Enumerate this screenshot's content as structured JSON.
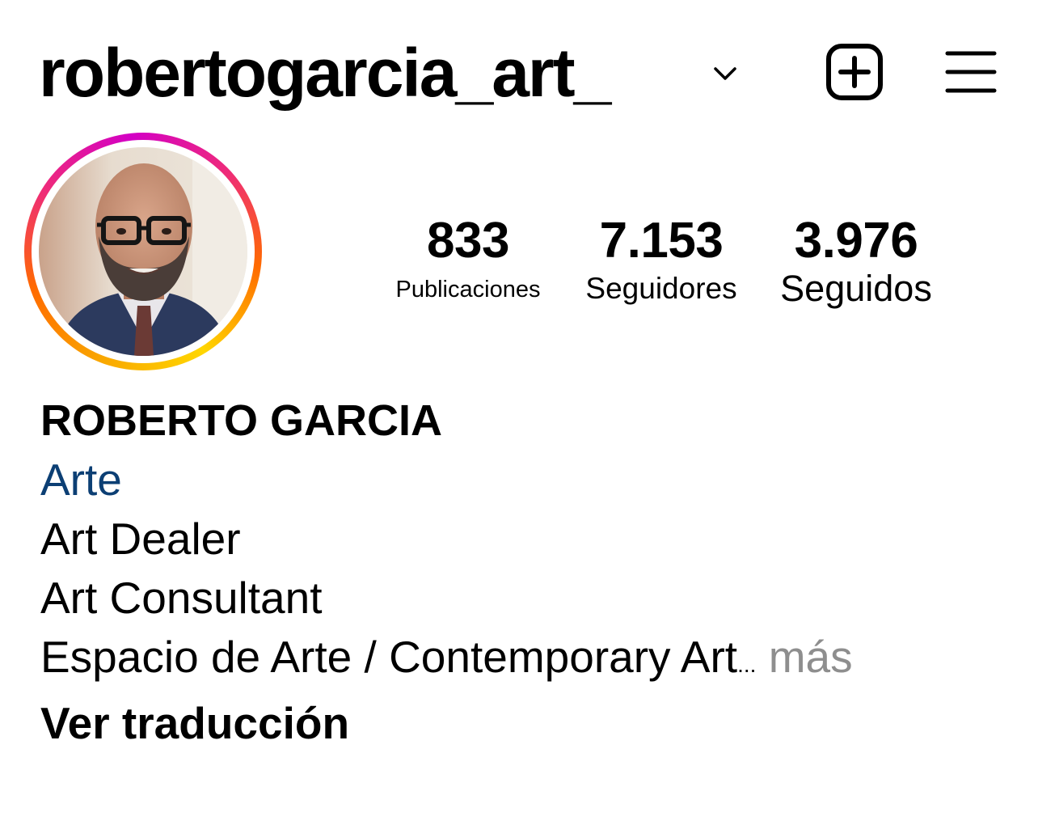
{
  "header": {
    "username": "robertogarcia_art_",
    "icons": {
      "dropdown": "chevron-down-icon",
      "create": "plus-square-icon",
      "menu": "hamburger-menu-icon"
    }
  },
  "stats": {
    "posts": {
      "count": "833",
      "label": "Publicaciones"
    },
    "followers": {
      "count": "7.153",
      "label": "Seguidores"
    },
    "following": {
      "count": "3.976",
      "label": "Seguidos"
    }
  },
  "bio": {
    "name": "ROBERTO GARCIA",
    "category": "Arte",
    "lines": [
      "Art Dealer",
      "Art Consultant",
      "Espacio de Arte / Contemporary Art"
    ],
    "ellipsis": "...",
    "more": "más",
    "translate": "Ver traducción"
  },
  "colors": {
    "category_link": "#0c3f74",
    "more_text": "#8e8e8e",
    "story_ring": [
      "#f9a800",
      "#ff6a00",
      "#ee2a7b",
      "#d300c5"
    ]
  }
}
